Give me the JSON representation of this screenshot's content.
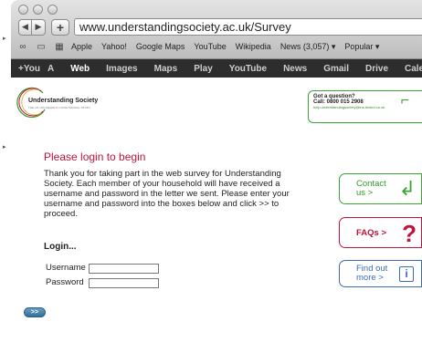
{
  "browser": {
    "url": "www.understandingsociety.ac.uk/Survey",
    "nav_back": "◀",
    "nav_forward": "▶",
    "new_tab": "+",
    "bookmarks": [
      "Apple",
      "Yahoo!",
      "Google Maps",
      "YouTube",
      "Wikipedia",
      "News (3,057) ▾",
      "Popular ▾"
    ]
  },
  "google_bar": {
    "items": [
      "+You",
      "A",
      "Web",
      "Images",
      "Maps",
      "Play",
      "YouTube",
      "News",
      "Gmail",
      "Drive",
      "Calendar"
    ],
    "active": "Web"
  },
  "logo": {
    "title": "Understanding Society",
    "subtitle": "THE UK HOUSEHOLD LONGITUDINAL STUDY"
  },
  "help_box": {
    "line1": "Got a question?",
    "line2": "Call: 0800 015 2908",
    "line3": "help.understandingsociety@ins-bristol.co.uk"
  },
  "main": {
    "heading": "Please login to begin",
    "intro": "Thank you for taking part in the web survey for Understanding Society. Each member of your household will have received a username and password in the letter we sent. Please enter your username and password into the boxes below and click >> to proceed.",
    "login_label": "Login...",
    "username_label": "Username",
    "password_label": "Password",
    "submit_label": ">>"
  },
  "sidebar": {
    "contact_line1": "Contact",
    "contact_line2": "us >",
    "faqs": "FAQs >",
    "findout_line1": "Find out",
    "findout_line2": "more >"
  },
  "colors": {
    "brand_red": "#c0143c",
    "brand_green": "#3aa535",
    "brand_blue": "#3b6db5"
  }
}
